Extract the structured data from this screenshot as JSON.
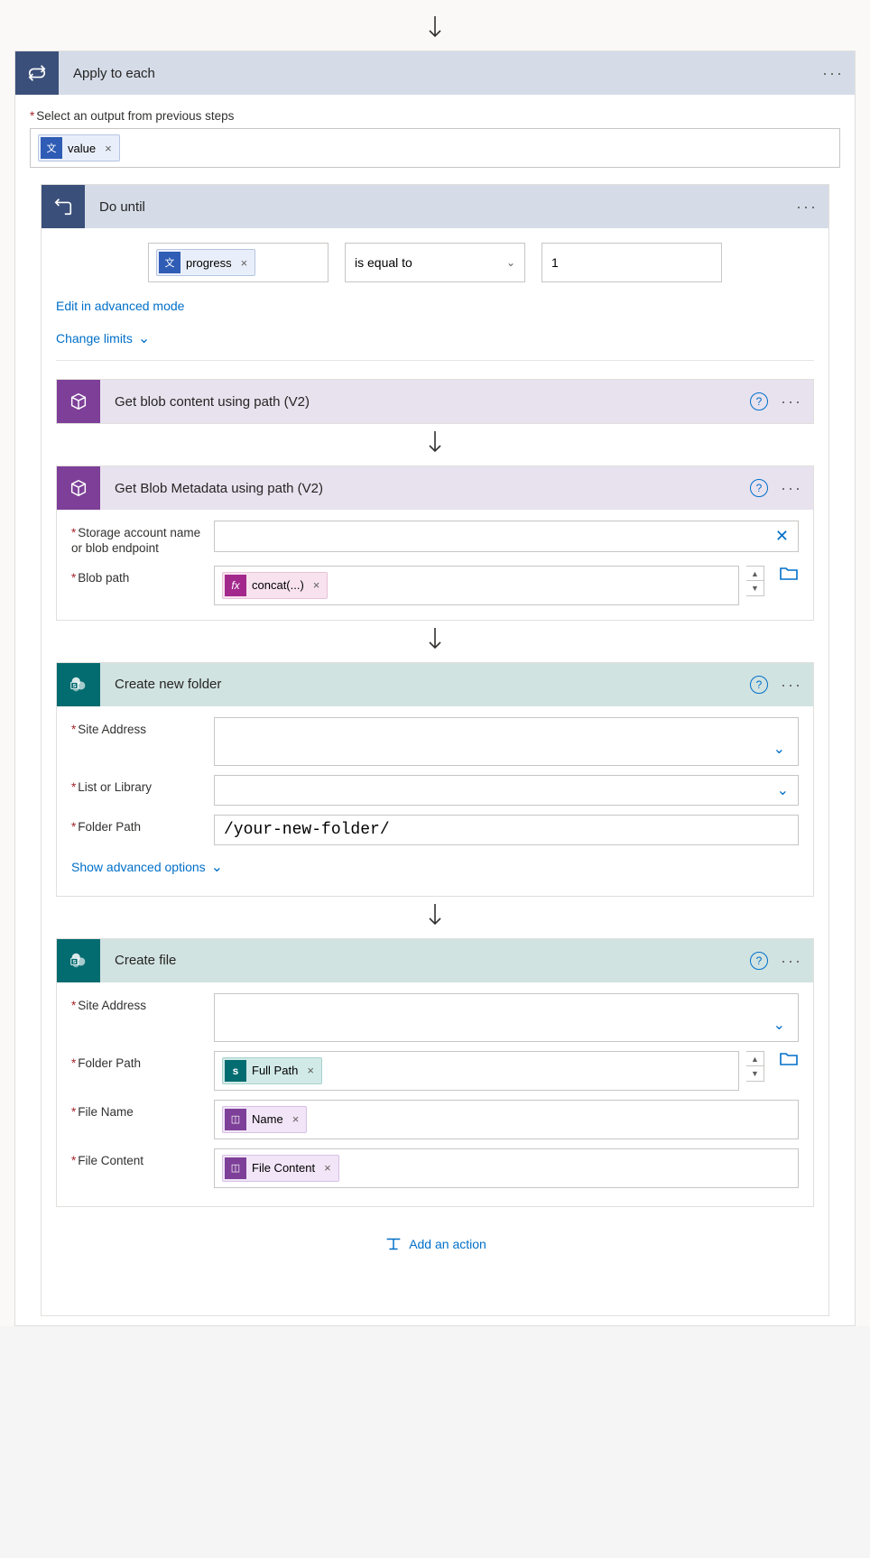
{
  "applyToEach": {
    "title": "Apply to each",
    "selectLabel": "Select an output from previous steps",
    "token": "value"
  },
  "doUntil": {
    "title": "Do until",
    "leftToken": "progress",
    "operator": "is equal to",
    "rightValue": "1",
    "editAdvanced": "Edit in advanced mode",
    "changeLimits": "Change limits"
  },
  "getBlobContent": {
    "title": "Get blob content using path (V2)"
  },
  "getBlobMetadata": {
    "title": "Get Blob Metadata using path (V2)",
    "storageLabel": "Storage account name or blob endpoint",
    "blobPathLabel": "Blob path",
    "concatToken": "concat(...)"
  },
  "createFolder": {
    "title": "Create new folder",
    "siteAddressLabel": "Site Address",
    "siteAddressValue": "",
    "listLabel": "List or Library",
    "folderPathLabel": "Folder Path",
    "folderPathValue": "/your-new-folder/",
    "showAdvanced": "Show advanced options"
  },
  "createFile": {
    "title": "Create file",
    "siteAddressLabel": "Site Address",
    "folderPathLabel": "Folder Path",
    "folderPathToken": "Full Path",
    "fileNameLabel": "File Name",
    "fileNameToken": "Name",
    "fileContentLabel": "File Content",
    "fileContentToken": "File Content"
  },
  "addAction": "Add an action"
}
